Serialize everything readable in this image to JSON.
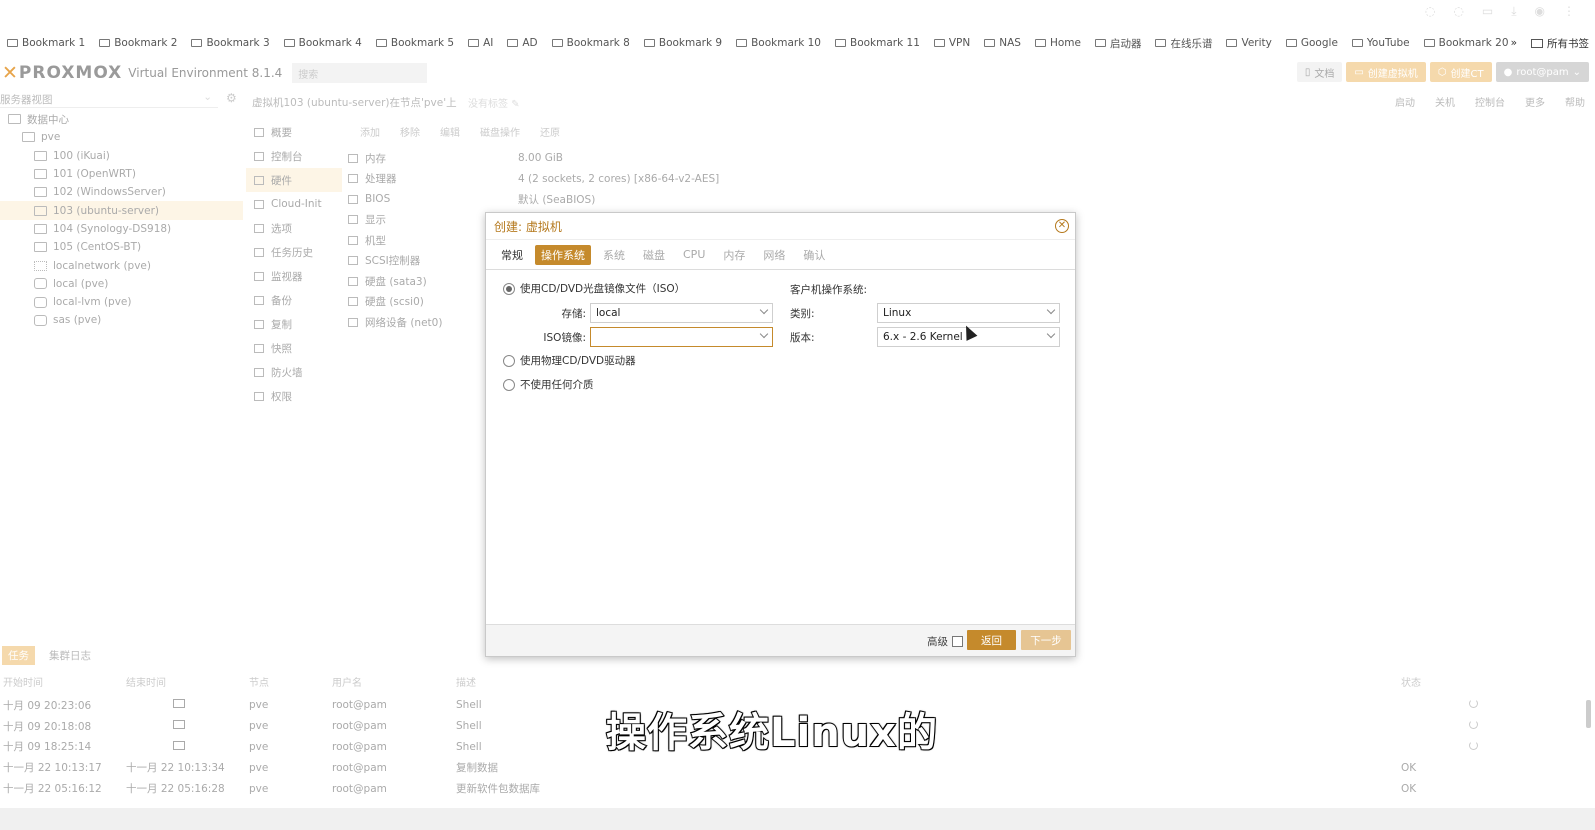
{
  "browser": {
    "bookmarks": [
      "Bookmark 1",
      "Bookmark 2",
      "Bookmark 3",
      "Bookmark 4",
      "Bookmark 5",
      "AI",
      "AD",
      "Bookmark 8",
      "Bookmark 9",
      "Bookmark 10",
      "Bookmark 11",
      "VPN",
      "NAS",
      "Home",
      "启动器",
      "在线乐谱",
      "Verity",
      "Google",
      "YouTube",
      "Bookmark 20"
    ],
    "overflow": "»",
    "all_bookmarks": "所有书签"
  },
  "header": {
    "logo": "PROXMOX",
    "product": "Virtual Environment 8.1.4",
    "search_placeholder": "搜索",
    "doc": "文档",
    "create_vm": "创建虚拟机",
    "create_ct": "创建CT",
    "user": "root@pam"
  },
  "tree": {
    "view": "服务器视图",
    "items": [
      {
        "label": "数据中心",
        "indent": 8
      },
      {
        "label": "pve",
        "indent": 22
      },
      {
        "label": "100 (iKuai)",
        "indent": 34
      },
      {
        "label": "101 (OpenWRT)",
        "indent": 34
      },
      {
        "label": "102 (WindowsServer)",
        "indent": 34
      },
      {
        "label": "103 (ubuntu-server)",
        "indent": 34,
        "selected": true
      },
      {
        "label": "104 (Synology-DS918)",
        "indent": 34
      },
      {
        "label": "105 (CentOS-BT)",
        "indent": 34
      },
      {
        "label": "localnetwork (pve)",
        "indent": 34
      },
      {
        "label": "local (pve)",
        "indent": 34
      },
      {
        "label": "local-lvm (pve)",
        "indent": 34
      },
      {
        "label": "sas (pve)",
        "indent": 34
      }
    ]
  },
  "vm": {
    "title": "虚拟机103 (ubuntu-server)在节点'pve'上",
    "tags": "没有标签",
    "actions": [
      "启动",
      "关机",
      "控制台",
      "更多",
      "帮助"
    ]
  },
  "nav": [
    "概要",
    "控制台",
    "硬件",
    "Cloud-Init",
    "选项",
    "任务历史",
    "监视器",
    "备份",
    "复制",
    "快照",
    "防火墙",
    "权限"
  ],
  "hw_toolbar": [
    "添加",
    "移除",
    "编辑",
    "磁盘操作",
    "还原"
  ],
  "hardware": [
    {
      "k": "内存",
      "v": "8.00 GiB"
    },
    {
      "k": "处理器",
      "v": "4 (2 sockets, 2 cores) [x86-64-v2-AES]"
    },
    {
      "k": "BIOS",
      "v": "默认 (SeaBIOS)"
    },
    {
      "k": "显示",
      "v": ""
    },
    {
      "k": "机型",
      "v": ""
    },
    {
      "k": "SCSI控制器",
      "v": ""
    },
    {
      "k": "硬盘 (sata3)",
      "v": ""
    },
    {
      "k": "硬盘 (scsi0)",
      "v": ""
    },
    {
      "k": "网络设备 (net0)",
      "v": ""
    }
  ],
  "tasks": {
    "tabs": [
      "任务",
      "集群日志"
    ],
    "headers": [
      "开始时间",
      "结束时间",
      "节点",
      "用户名",
      "描述",
      "状态"
    ],
    "rows": [
      {
        "start": "十月 09 20:23:06",
        "end": "",
        "node": "pve",
        "user": "root@pam",
        "desc": "Shell",
        "status": "",
        "running": true
      },
      {
        "start": "十月 09 20:18:08",
        "end": "",
        "node": "pve",
        "user": "root@pam",
        "desc": "Shell",
        "status": "",
        "running": true
      },
      {
        "start": "十月 09 18:25:14",
        "end": "",
        "node": "pve",
        "user": "root@pam",
        "desc": "Shell",
        "status": "",
        "running": true
      },
      {
        "start": "十一月 22 10:13:17",
        "end": "十一月 22 10:13:34",
        "node": "pve",
        "user": "root@pam",
        "desc": "复制数据",
        "status": "OK",
        "running": false
      },
      {
        "start": "十一月 22 05:16:12",
        "end": "十一月 22 05:16:28",
        "node": "pve",
        "user": "root@pam",
        "desc": "更新软件包数据库",
        "status": "OK",
        "running": false
      }
    ]
  },
  "modal": {
    "title": "创建: 虚拟机",
    "tabs": [
      "常规",
      "操作系统",
      "系统",
      "磁盘",
      "CPU",
      "内存",
      "网络",
      "确认"
    ],
    "active_tab": 1,
    "opt_iso": "使用CD/DVD光盘镜像文件（ISO）",
    "storage_label": "存储:",
    "storage_value": "local",
    "iso_label": "ISO镜像:",
    "iso_value": "",
    "opt_physical": "使用物理CD/DVD驱动器",
    "opt_none": "不使用任何介质",
    "guest_title": "客户机操作系统:",
    "type_label": "类别:",
    "type_value": "Linux",
    "version_label": "版本:",
    "version_value": "6.x - 2.6 Kernel",
    "advanced": "高级",
    "back": "返回",
    "next": "下一步"
  },
  "subtitle": "操作系统Linux的"
}
